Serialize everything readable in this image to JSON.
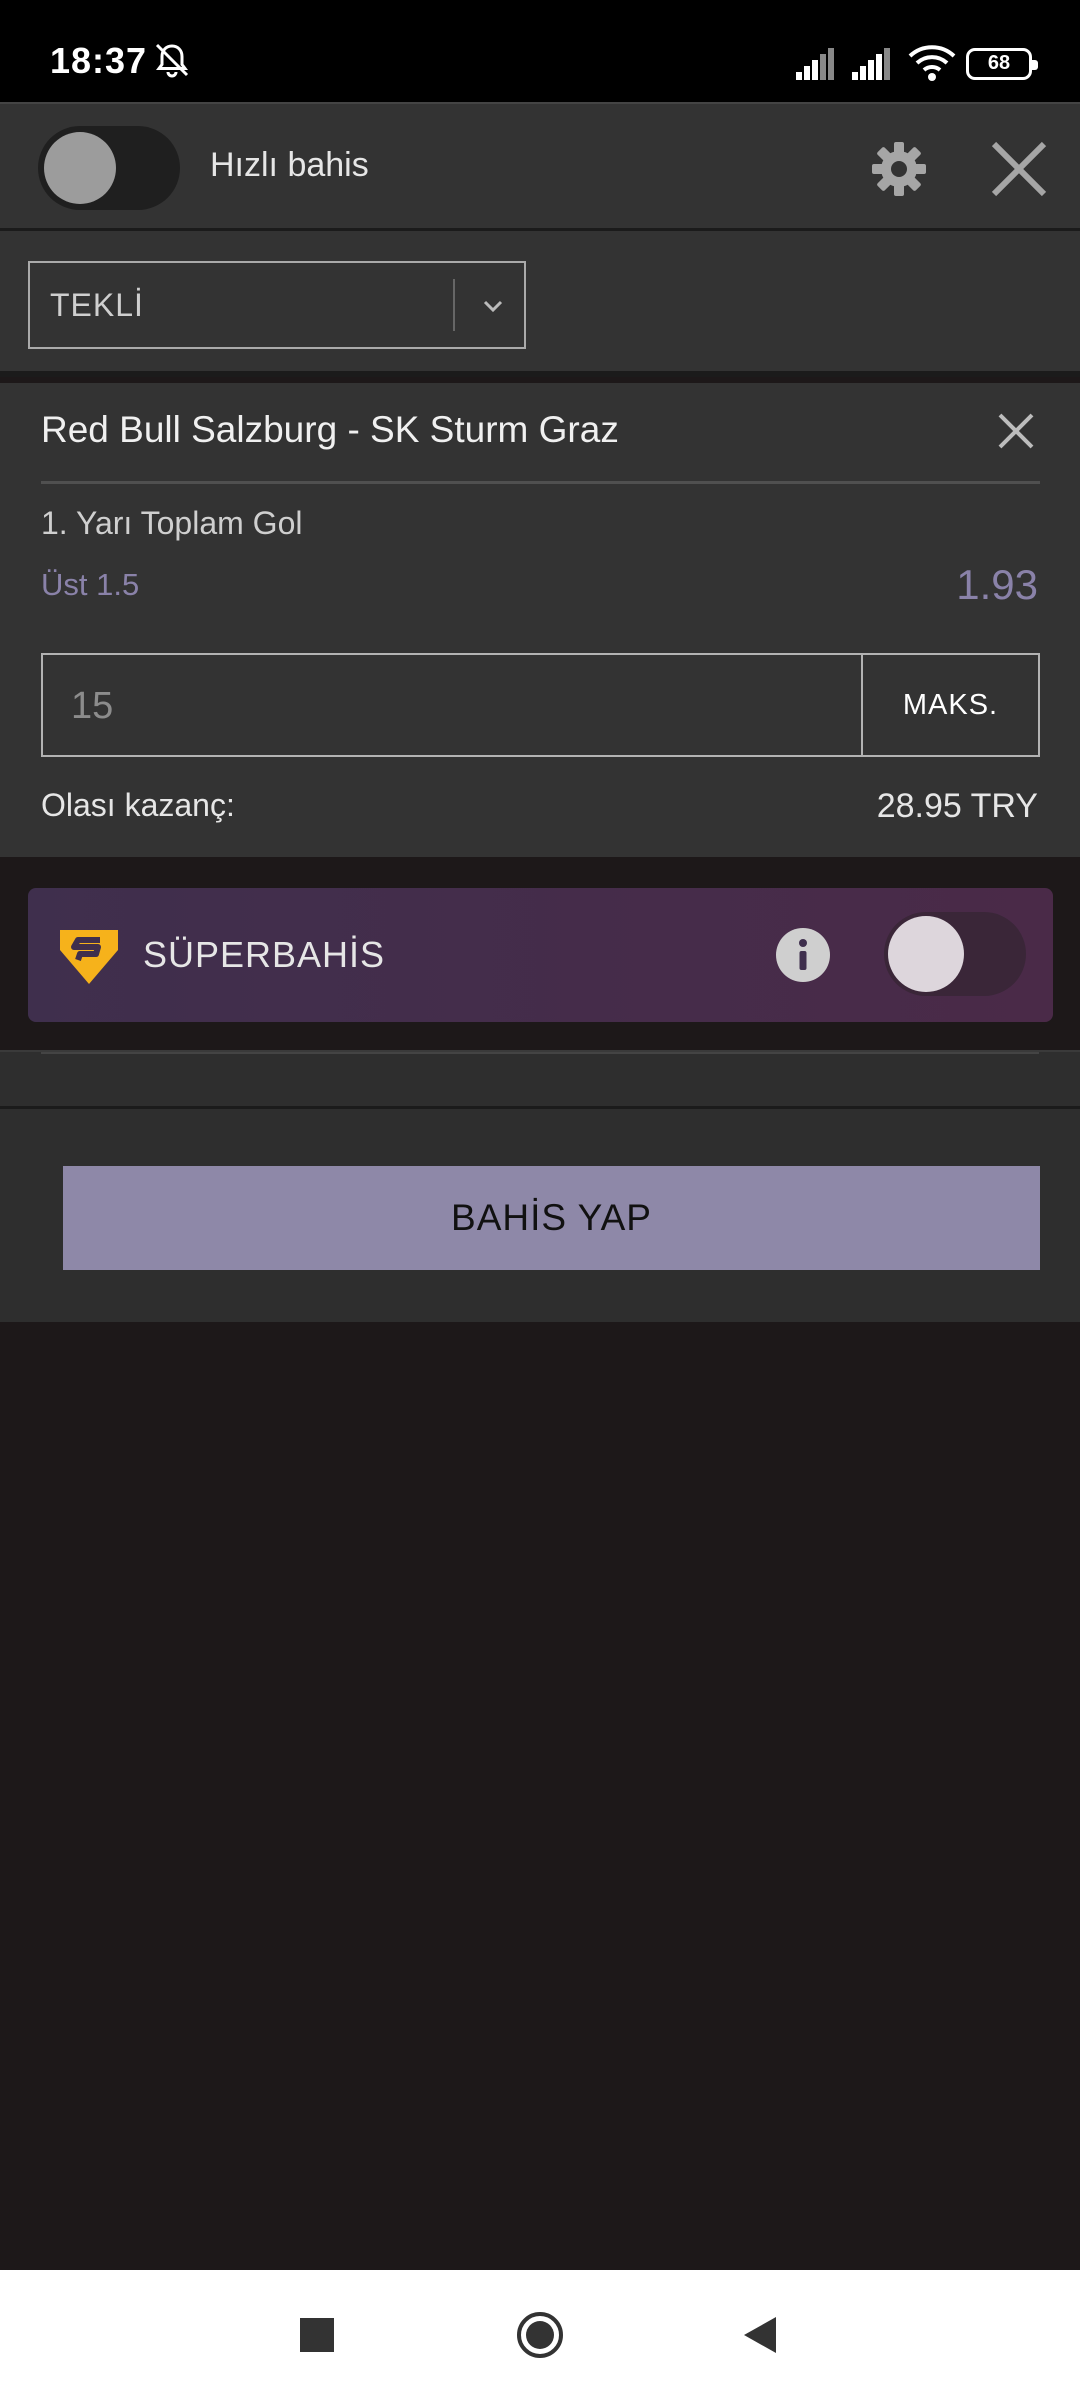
{
  "status_bar": {
    "time": "18:37",
    "battery": "68",
    "icons": [
      "bell-off-icon",
      "signal-icon",
      "signal-icon",
      "wifi-icon",
      "battery-icon"
    ]
  },
  "header": {
    "quick_bet_label": "Hızlı bahis",
    "quick_bet_enabled": false
  },
  "bet_type": {
    "selected": "TEKLİ"
  },
  "bet_card": {
    "match": "Red Bull Salzburg - SK Sturm Graz",
    "market": "1. Yarı Toplam Gol",
    "selection": "Üst 1.5",
    "odds": "1.93",
    "stake": "15",
    "max_label": "MAKS.",
    "winnings_label": "Olası kazanç:",
    "winnings_value": "28.95 TRY"
  },
  "superbahis": {
    "label": "SÜPERBAHİS",
    "enabled": false
  },
  "place_bet": {
    "label": "BAHİS YAP"
  },
  "colors": {
    "accent": "#8e88a8",
    "odds": "#8a82a9",
    "panel": "#333333",
    "background": "#1d1819",
    "logo": "#f6b21b"
  }
}
